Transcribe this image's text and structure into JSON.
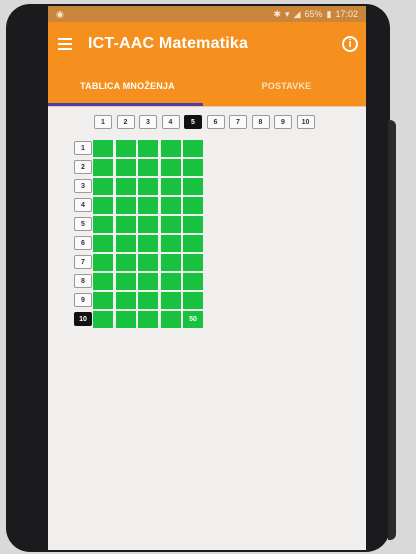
{
  "status_bar": {
    "left_icon": "circle-icon",
    "battery_percent": "65%",
    "time": "17:02"
  },
  "app_bar": {
    "title": "ICT-AAC Matematika",
    "menu_icon": "hamburger-menu-icon",
    "info_icon": "info-icon"
  },
  "tabs": [
    {
      "label": "TABLICA MNOŽENJA",
      "active": true
    },
    {
      "label": "POSTAVKE",
      "active": false
    }
  ],
  "table": {
    "column_headers": [
      "1",
      "2",
      "3",
      "4",
      "5",
      "6",
      "7",
      "8",
      "9",
      "10"
    ],
    "row_headers": [
      "1",
      "2",
      "3",
      "4",
      "5",
      "6",
      "7",
      "8",
      "9",
      "10"
    ],
    "selected_column": "5",
    "selected_row": "10",
    "result": "50",
    "fill_color": "#18c23e",
    "selected_color": "#111111"
  }
}
